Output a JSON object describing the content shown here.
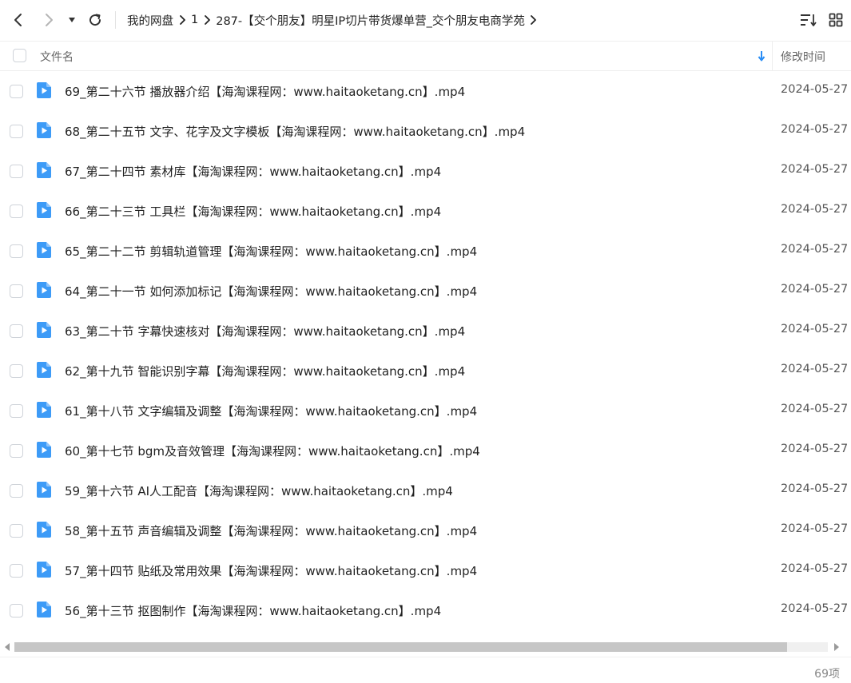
{
  "toolbar": {
    "back_icon": "chevron-left-icon",
    "forward_icon": "chevron-right-icon",
    "history_icon": "caret-down-icon",
    "refresh_icon": "refresh-icon",
    "sort_icon": "sort-list-icon",
    "view_icon": "grid-view-icon"
  },
  "breadcrumb": [
    {
      "label": "我的网盘"
    },
    {
      "label": "1"
    },
    {
      "label": "287-【交个朋友】明星IP切片带货爆单营_交个朋友电商学苑"
    }
  ],
  "header": {
    "name_label": "文件名",
    "time_label": "修改时间",
    "sort_icon": "arrow-down-icon"
  },
  "files": [
    {
      "name": "69_第二十六节 播放器介绍【海淘课程网：www.haitaoketang.cn】.mp4",
      "modified": "2024-05-27"
    },
    {
      "name": "68_第二十五节 文字、花字及文字模板【海淘课程网：www.haitaoketang.cn】.mp4",
      "modified": "2024-05-27"
    },
    {
      "name": "67_第二十四节 素材库【海淘课程网：www.haitaoketang.cn】.mp4",
      "modified": "2024-05-27"
    },
    {
      "name": "66_第二十三节 工具栏【海淘课程网：www.haitaoketang.cn】.mp4",
      "modified": "2024-05-27"
    },
    {
      "name": "65_第二十二节 剪辑轨道管理【海淘课程网：www.haitaoketang.cn】.mp4",
      "modified": "2024-05-27"
    },
    {
      "name": "64_第二十一节 如何添加标记【海淘课程网：www.haitaoketang.cn】.mp4",
      "modified": "2024-05-27"
    },
    {
      "name": "63_第二十节 字幕快速核对【海淘课程网：www.haitaoketang.cn】.mp4",
      "modified": "2024-05-27"
    },
    {
      "name": "62_第十九节 智能识别字幕【海淘课程网：www.haitaoketang.cn】.mp4",
      "modified": "2024-05-27"
    },
    {
      "name": "61_第十八节 文字编辑及调整【海淘课程网：www.haitaoketang.cn】.mp4",
      "modified": "2024-05-27"
    },
    {
      "name": "60_第十七节 bgm及音效管理【海淘课程网：www.haitaoketang.cn】.mp4",
      "modified": "2024-05-27"
    },
    {
      "name": "59_第十六节 AI人工配音【海淘课程网：www.haitaoketang.cn】.mp4",
      "modified": "2024-05-27"
    },
    {
      "name": "58_第十五节 声音编辑及调整【海淘课程网：www.haitaoketang.cn】.mp4",
      "modified": "2024-05-27"
    },
    {
      "name": "57_第十四节 贴纸及常用效果【海淘课程网：www.haitaoketang.cn】.mp4",
      "modified": "2024-05-27"
    },
    {
      "name": "56_第十三节 抠图制作【海淘课程网：www.haitaoketang.cn】.mp4",
      "modified": "2024-05-27"
    }
  ],
  "file_icon": "video-file-icon",
  "scrollbar": {
    "thumb_fraction": 0.95
  },
  "status": {
    "item_count": "69项"
  },
  "colors": {
    "accent": "#2a8df5",
    "file_icon": "#3d9bf7",
    "text": "#222222",
    "muted": "#888888"
  }
}
